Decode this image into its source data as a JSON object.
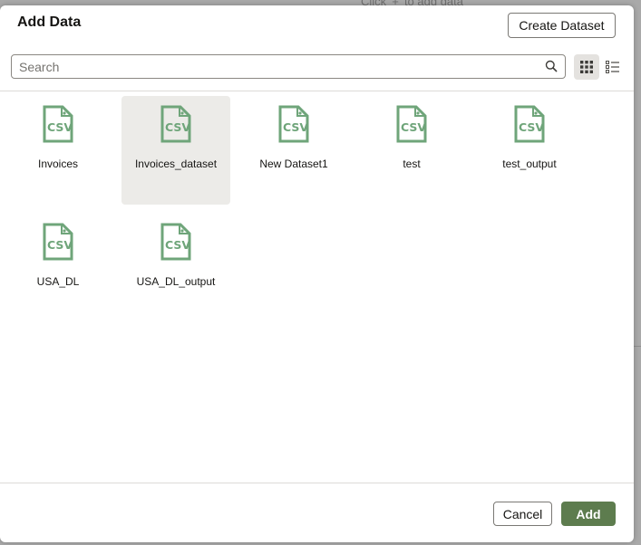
{
  "background": {
    "hint_text": "Click '+' to add data"
  },
  "dialog": {
    "title": "Add Data",
    "create_dataset_label": "Create Dataset",
    "search": {
      "placeholder": "Search",
      "value": "",
      "icon": "search-icon"
    },
    "view_modes": [
      {
        "name": "grid",
        "icon": "grid-view-icon",
        "active": true
      },
      {
        "name": "list",
        "icon": "list-view-icon",
        "active": false
      }
    ],
    "datasets": [
      {
        "label": "Invoices",
        "type": "CSV",
        "selected": false
      },
      {
        "label": "Invoices_dataset",
        "type": "CSV",
        "selected": true
      },
      {
        "label": "New Dataset1",
        "type": "CSV",
        "selected": false
      },
      {
        "label": "test",
        "type": "CSV",
        "selected": false
      },
      {
        "label": "test_output",
        "type": "CSV",
        "selected": false
      },
      {
        "label": "USA_DL",
        "type": "CSV",
        "selected": false
      },
      {
        "label": "USA_DL_output",
        "type": "CSV",
        "selected": false
      }
    ],
    "footer": {
      "cancel_label": "Cancel",
      "add_label": "Add"
    },
    "colors": {
      "icon_green": "#6fa57a",
      "add_button": "#5d7c4e",
      "selected_tile": "#ecebe8"
    }
  }
}
